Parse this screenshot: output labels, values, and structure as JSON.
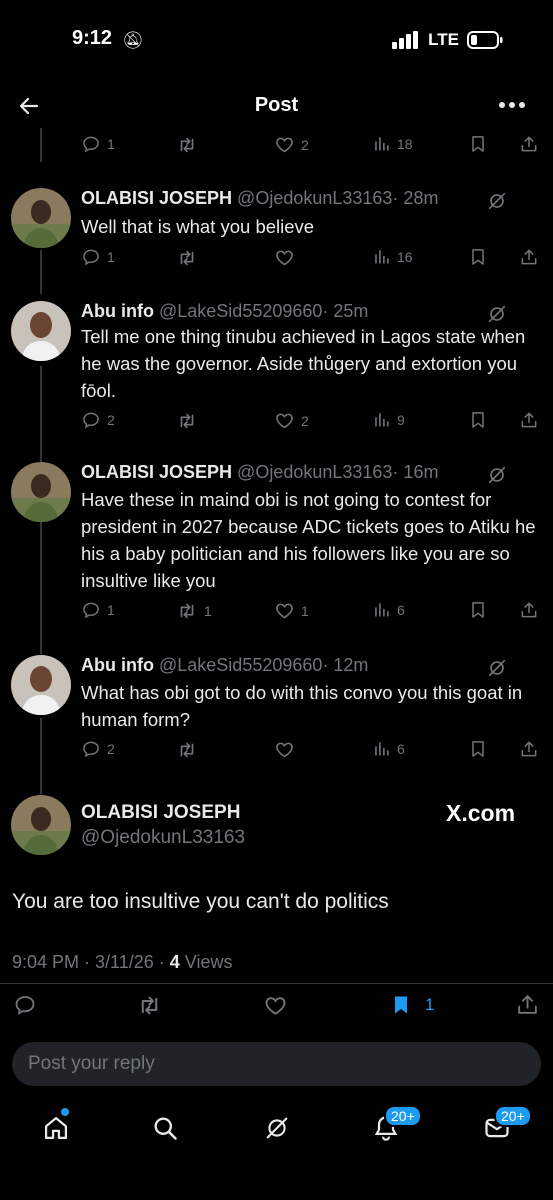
{
  "status": {
    "time": "9:12",
    "network": "LTE"
  },
  "header": {
    "title": "Post"
  },
  "top_actions": {
    "replies": "1",
    "reposts": "",
    "likes": "2",
    "views": "18"
  },
  "replies": [
    {
      "name": "OLABISI JOSEPH",
      "handle": "@OjedokunL33163",
      "time": "· 28m",
      "text": "Well that is what you believe",
      "replies": "1",
      "reposts": "",
      "likes": "",
      "views": "16"
    },
    {
      "name": "Abu info",
      "handle": "@LakeSid55209660",
      "time": "· 25m",
      "text": "Tell me one thing tinubu achieved in Lagos state when he was the governor.  Aside thůgery and extortion you fōol.",
      "replies": "2",
      "reposts": "",
      "likes": "2",
      "views": "9"
    },
    {
      "name": "OLABISI JOSEPH",
      "handle": "@OjedokunL33163",
      "time": "· 16m",
      "text": "Have these in maind obi is not going to contest for president in 2027 because ADC tickets goes to Atiku he his a baby politician and his followers like you are so insultive like you",
      "replies": "1",
      "reposts": "1",
      "likes": "1",
      "views": "6"
    },
    {
      "name": "Abu info",
      "handle": "@LakeSid55209660",
      "time": "· 12m",
      "text": "What has obi got to do with this convo you this goat in human form?",
      "replies": "2",
      "reposts": "",
      "likes": "",
      "views": "6"
    }
  ],
  "main_post": {
    "name": "OLABISI JOSEPH",
    "handle": "@OjedokunL33163",
    "watermark": "X.com",
    "text": "You are too insultive you can't do politics",
    "timestamp": "9:04 PM · 3/11/26 · ",
    "views_count": "4",
    "views_label": " Views",
    "bookmarks": "1"
  },
  "composer": {
    "placeholder": "Post your reply"
  },
  "tabbar": {
    "notifications_badge": "20+",
    "messages_badge": "20+"
  },
  "colors": {
    "background": "#000000",
    "accent": "#1d9bf0",
    "muted": "#71767b"
  }
}
